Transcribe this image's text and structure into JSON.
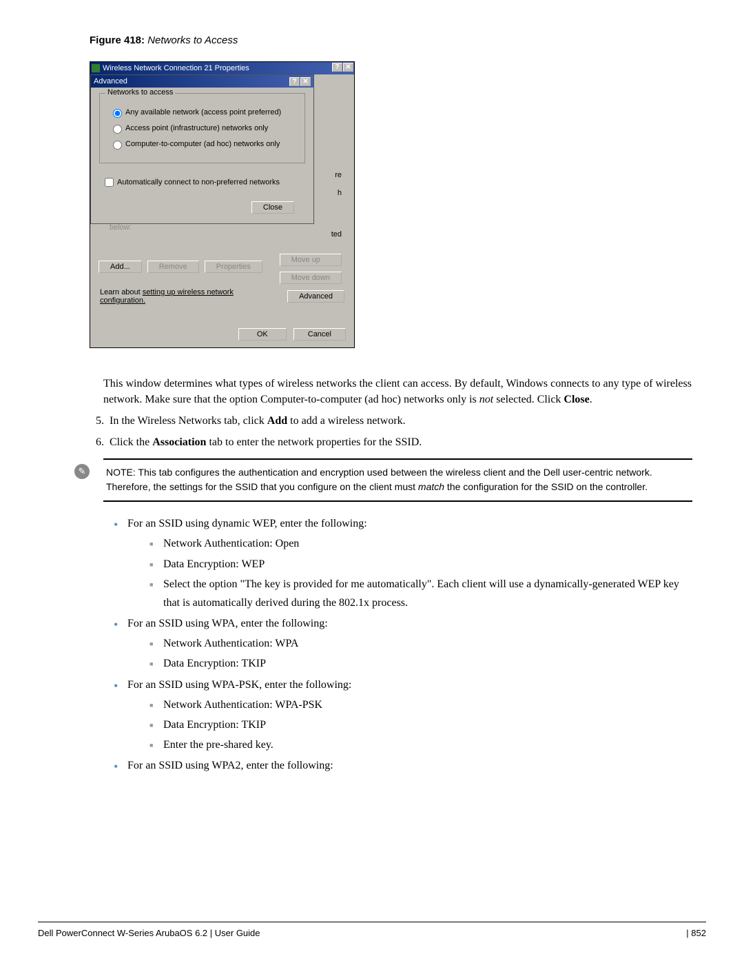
{
  "figure": {
    "label": "Figure 418:",
    "title": "Networks to Access"
  },
  "dialog1": {
    "title": "Wireless Network Connection 21 Properties",
    "help": "?",
    "close": "✕"
  },
  "dialog2": {
    "title": "Advanced",
    "help": "?",
    "close": "✕",
    "group": "Networks to access",
    "r1": "Any available network (access point preferred)",
    "r2": "Access point (infrastructure) networks only",
    "r3": "Computer-to-computer (ad hoc) networks only",
    "chk": "Automatically connect to non-preferred networks",
    "closeBtn": "Close"
  },
  "bg": {
    "frag1": "re",
    "frag2": "h",
    "frag3": "ted",
    "below": "below:",
    "moveup": "Move up",
    "movedown": "Move down",
    "add": "Add...",
    "remove": "Remove",
    "properties": "Properties",
    "learn1": "Learn about ",
    "learnLink": "setting up wireless network",
    "learn2": "configuration.",
    "advanced": "Advanced",
    "ok": "OK",
    "cancel": "Cancel"
  },
  "para1a": "This window determines what types of wireless networks the client can access. By default, Windows connects to any type of wireless network. Make sure that the option Computer-to-computer (ad hoc) networks only is ",
  "para1b": "not",
  "para1c": " selected. Click ",
  "para1d": "Close",
  "para1e": ".",
  "step5a": "In the Wireless Networks tab, click ",
  "step5b": "Add",
  "step5c": " to add a wireless network.",
  "step6a": "Click the ",
  "step6b": "Association",
  "step6c": " tab to enter the network properties for the SSID.",
  "note1": "NOTE: This tab configures the authentication and encryption used between the wireless client and the Dell user-centric network. Therefore, the settings for the SSID that you configure on the client must ",
  "note2": "match",
  "note3": " the configuration for the SSID on the controller.",
  "li": {
    "wep": "For an SSID using dynamic WEP, enter the following:",
    "wep_a": "Network Authentication: Open",
    "wep_b": "Data Encryption: WEP",
    "wep_c": "Select the option \"The key is provided for me automatically\". Each client will use a dynamically-generated WEP key that is automatically derived during the 802.1x process.",
    "wpa": "For an SSID using WPA, enter the following:",
    "wpa_a": "Network Authentication: WPA",
    "wpa_b": "Data Encryption: TKIP",
    "psk": "For an SSID using WPA-PSK, enter the following:",
    "psk_a": "Network Authentication: WPA-PSK",
    "psk_b": "Data Encryption: TKIP",
    "psk_c": "Enter the pre-shared key.",
    "wpa2": "For an SSID using WPA2, enter the following:"
  },
  "footer": {
    "left": "Dell PowerConnect W-Series ArubaOS 6.2",
    "mid": "User Guide",
    "right": "852"
  }
}
